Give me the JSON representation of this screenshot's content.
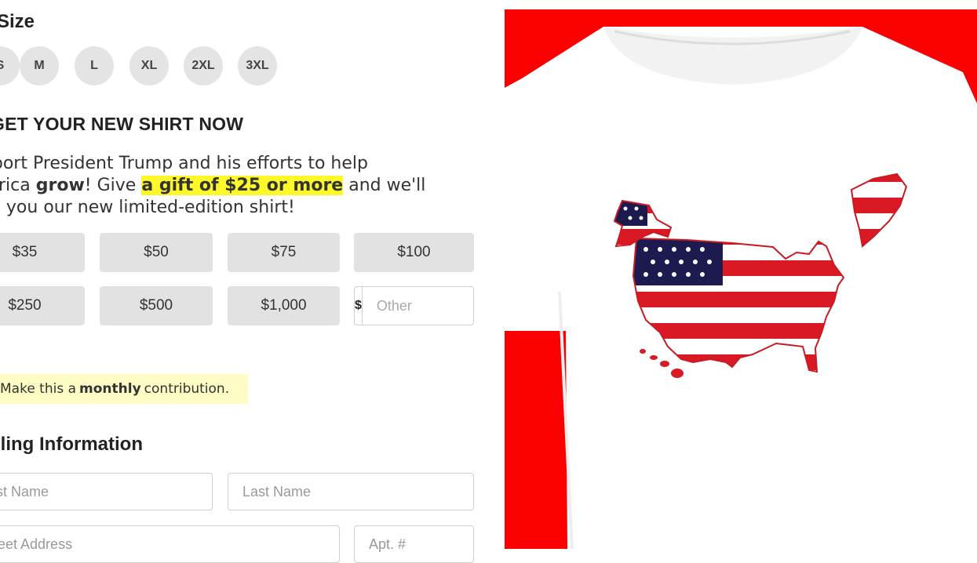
{
  "size_section": {
    "title": "Size",
    "options": [
      "S",
      "M",
      "L",
      "XL",
      "2XL",
      "3XL"
    ]
  },
  "offer": {
    "heading": "GET YOUR NEW SHIRT NOW",
    "text_part1": "Support President Trump and his efforts to help America ",
    "text_bold": "grow",
    "text_part2": "! Give ",
    "text_highlight": "a gift of $25 or more",
    "text_part3": " and we'll send you our new limited-edition shirt!"
  },
  "amounts": [
    "$35",
    "$50",
    "$75",
    "$100",
    "$250",
    "$500",
    "$1,000"
  ],
  "other_amount": {
    "currency_symbol": "$",
    "placeholder": "Other"
  },
  "monthly": {
    "text_before": "Make this a ",
    "text_bold": "monthly",
    "text_after": " contribution."
  },
  "billing": {
    "heading": "Billing Information",
    "first_name_placeholder": "First Name",
    "last_name_placeholder": "Last Name",
    "street_placeholder": "Street Address",
    "apt_placeholder": "Apt. #"
  },
  "colors": {
    "background_red": "#fa0000",
    "shirt_white": "#ffffff",
    "highlight_yellow": "#fdf82a",
    "monthly_box_yellow": "#fcfcc4",
    "button_gray": "#e2e2e2",
    "flag_red": "#d91a24",
    "flag_blue": "#1c1a4e"
  }
}
